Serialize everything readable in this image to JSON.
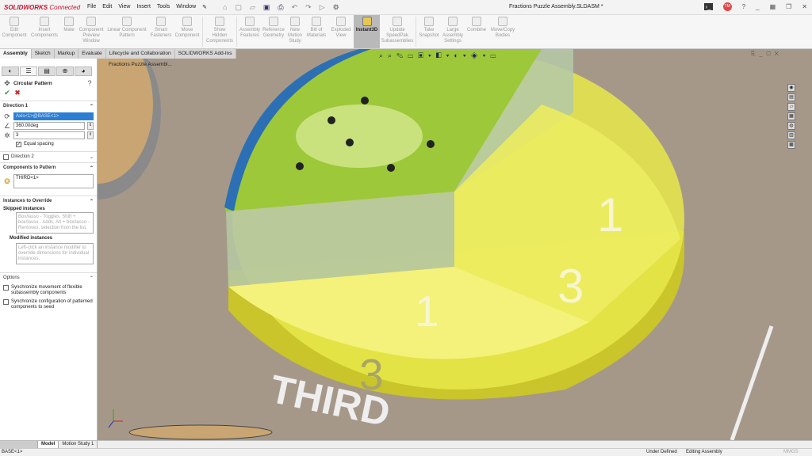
{
  "app": {
    "logo": "SOLIDWORKS",
    "logo_suffix": "Connected",
    "title": "Fractions Puzzle Assembly.SLDASM *",
    "avatar": "TM"
  },
  "menu": [
    "File",
    "Edit",
    "View",
    "Insert",
    "Tools",
    "Window"
  ],
  "ribbon": [
    "Edit Component",
    "Insert Components",
    "Mate",
    "Component Preview Window",
    "Linear Component Pattern",
    "Smart Fasteners",
    "Move Component",
    "Show Hidden Components",
    "Assembly Features",
    "Reference Geometry",
    "New Motion Study",
    "Bill of Materials",
    "Exploded View",
    "Instant3D",
    "Update SpeedPak Subassemblies",
    "Take Snapshot",
    "Large Assembly Settings",
    "Combine",
    "Move/Copy Bodies"
  ],
  "tabs": [
    "Assembly",
    "Sketch",
    "Markup",
    "Evaluate",
    "Lifecycle and Collaboration",
    "SOLIDWORKS Add-Ins"
  ],
  "tree_title": "Fractions Puzzle Assembl...",
  "panel": {
    "title": "Circular Pattern",
    "direction1": "Direction 1",
    "axis": "Axis<1>@BASE<1>",
    "angle": "360.00deg",
    "count": "3",
    "equal_spacing": "Equal spacing",
    "direction2": "Direction 2",
    "components": "Components to Pattern",
    "component": "THIRD<1>",
    "override": "Instances to Override",
    "skipped": "Skipped instances",
    "skipped_hint": "Box/lasso - Toggles, Shift + box/lasso - Adds, Alt + box/lasso - Removes, selection from the list.",
    "modified": "Modified instances",
    "modified_hint": "Left-click an instance modifier to override dimensions for individual instances.",
    "options": "Options",
    "opt1": "Synchronize movement of flexible subassembly components",
    "opt2": "Synchronize configuration of patterned components to seed"
  },
  "scene": {
    "fraction_num": "1",
    "fraction_den": "3",
    "label": "THIRD"
  },
  "bottom_tabs": [
    "Model",
    "Motion Study 1"
  ],
  "status": {
    "selection": "BASE<1>",
    "state": "Under Defined",
    "mode": "Editing Assembly",
    "units": "MMGS"
  }
}
